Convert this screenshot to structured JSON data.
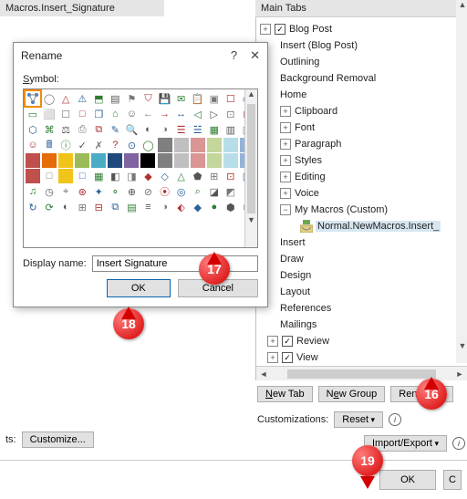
{
  "breadcrumb": "Macros.Insert_Signature",
  "main_tabs": {
    "header": "Main Tabs",
    "tree": [
      {
        "exp": "+",
        "chk": true,
        "label": "Blog Post",
        "indent": 0
      },
      {
        "exp": "",
        "chk": null,
        "label": "Insert (Blog Post)",
        "indent": 22
      },
      {
        "exp": "",
        "chk": null,
        "label": "Outlining",
        "indent": 22
      },
      {
        "exp": "",
        "chk": null,
        "label": "Background Removal",
        "indent": 22
      },
      {
        "exp": "",
        "chk": null,
        "label": "Home",
        "indent": 22
      },
      {
        "exp": "+",
        "chk": null,
        "label": "Clipboard",
        "indent": 22
      },
      {
        "exp": "+",
        "chk": null,
        "label": "Font",
        "indent": 22
      },
      {
        "exp": "+",
        "chk": null,
        "label": "Paragraph",
        "indent": 22
      },
      {
        "exp": "+",
        "chk": null,
        "label": "Styles",
        "indent": 22
      },
      {
        "exp": "+",
        "chk": null,
        "label": "Editing",
        "indent": 22
      },
      {
        "exp": "+",
        "chk": null,
        "label": "Voice",
        "indent": 22
      },
      {
        "exp": "−",
        "chk": null,
        "label": "My Macros (Custom)",
        "indent": 22,
        "kids": [
          {
            "label": "Normal.NewMacros.Insert_",
            "selected": true
          }
        ]
      },
      {
        "exp": "",
        "chk": null,
        "label": "Insert",
        "indent": 22
      },
      {
        "exp": "",
        "chk": null,
        "label": "Draw",
        "indent": 22
      },
      {
        "exp": "",
        "chk": null,
        "label": "Design",
        "indent": 22
      },
      {
        "exp": "",
        "chk": null,
        "label": "Layout",
        "indent": 22
      },
      {
        "exp": "",
        "chk": null,
        "label": "References",
        "indent": 22
      },
      {
        "exp": "",
        "chk": null,
        "label": "Mailings",
        "indent": 22
      },
      {
        "exp": "+",
        "chk": true,
        "label": "Review",
        "indent": 8
      },
      {
        "exp": "+",
        "chk": true,
        "label": "View",
        "indent": 8
      }
    ],
    "new_tab": "New Tab",
    "new_group": "New Group",
    "rename": "Rename...",
    "customizations": "Customizations:",
    "reset": "Reset",
    "import_export": "Import/Export"
  },
  "left": {
    "shortcuts_label": "ts:",
    "customize": "Customize..."
  },
  "footer": {
    "ok": "OK"
  },
  "dialog": {
    "title": "Rename",
    "symbol_label": "Symbol:",
    "display_name_label": "Display name:",
    "display_name_value": "Insert Signature",
    "ok": "OK",
    "cancel": "Cancel"
  },
  "callouts": {
    "c16": "16",
    "c17": "17",
    "c18": "18",
    "c19": "19"
  }
}
